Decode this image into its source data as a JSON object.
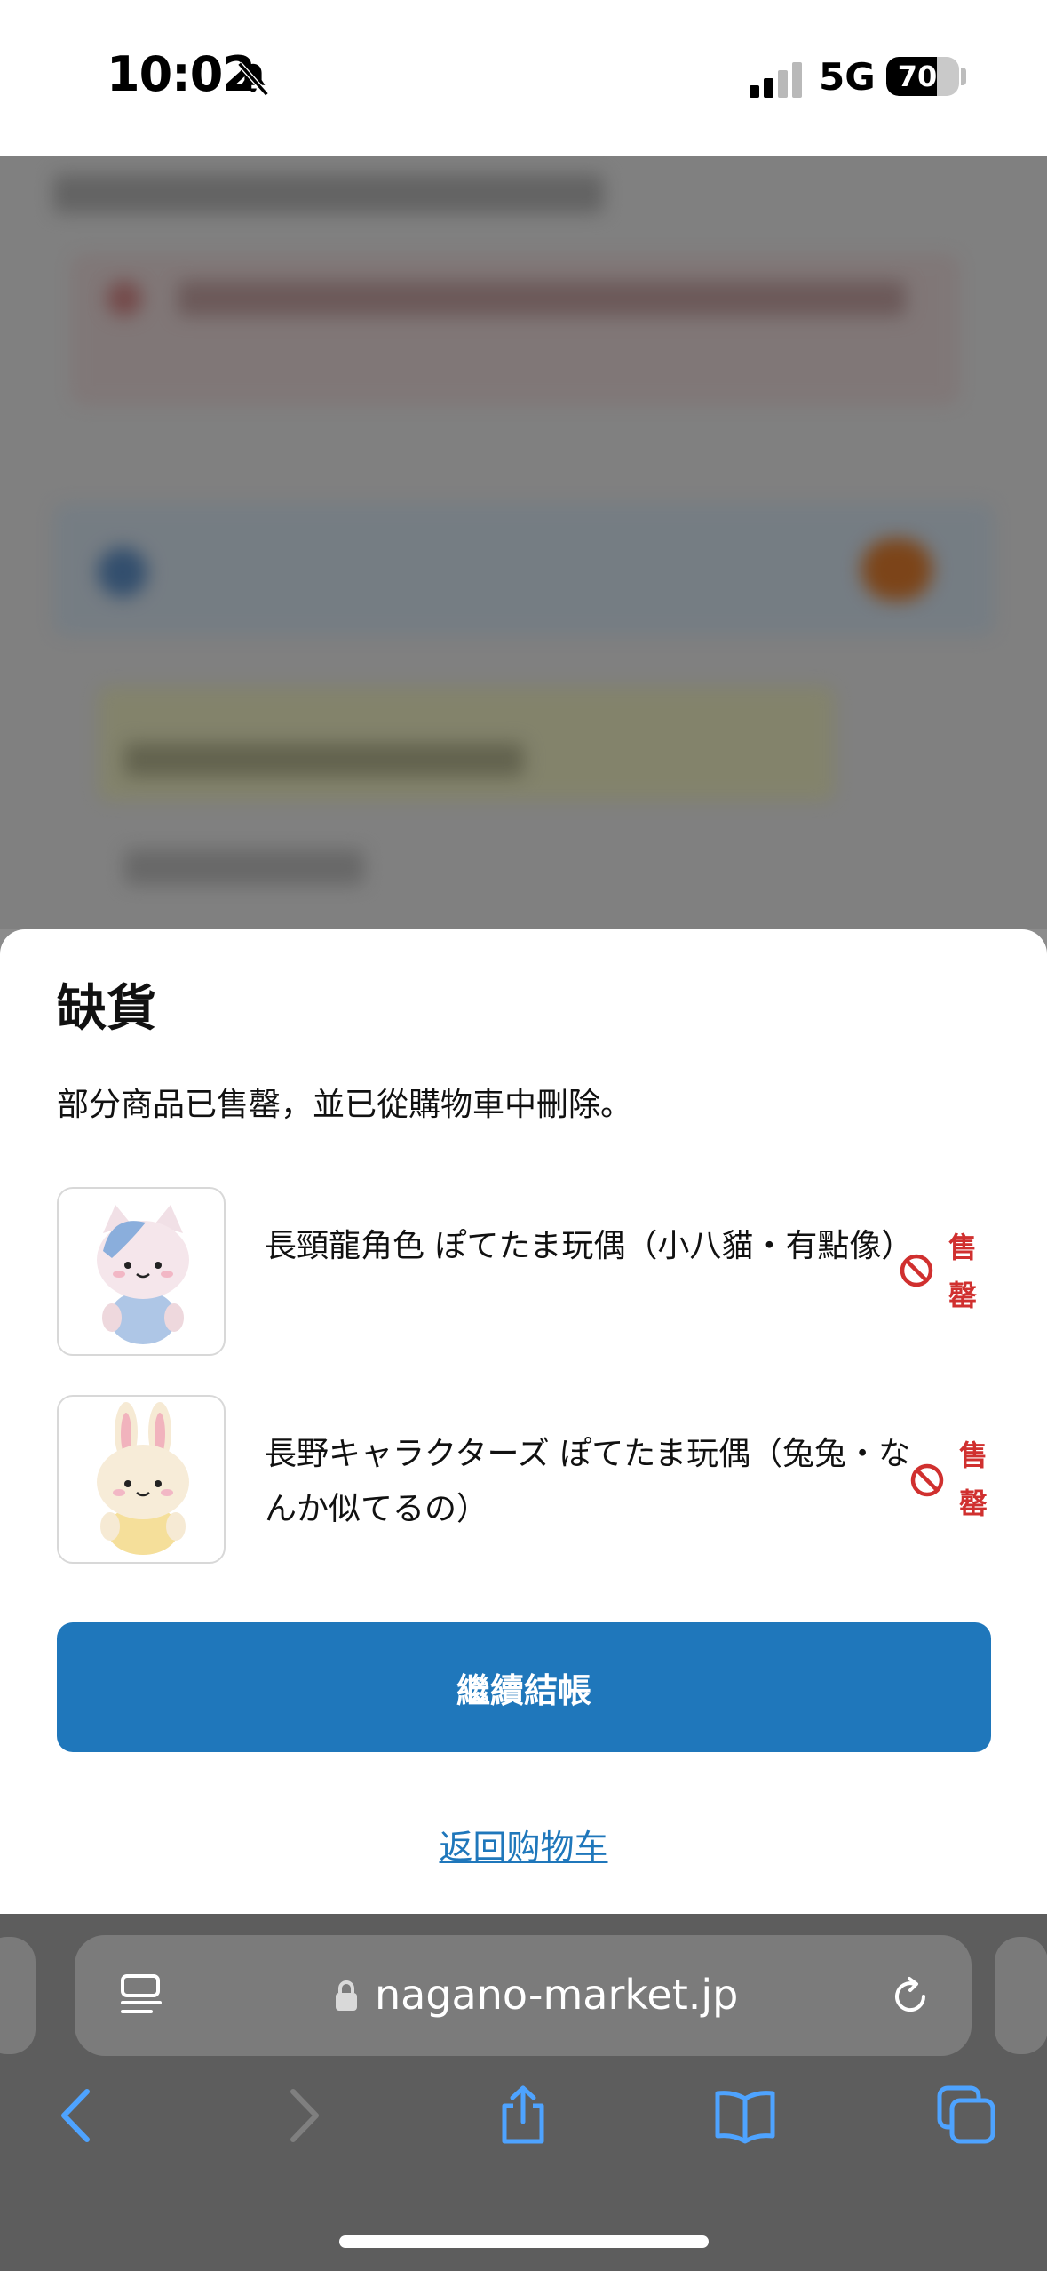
{
  "status_bar": {
    "time": "10:02",
    "network": "5G",
    "battery_percent": 70,
    "battery_label": "70"
  },
  "sheet": {
    "title": "缺貨",
    "message": "部分商品已售罄，並已從購物車中刪除。",
    "items": [
      {
        "name": "長頸龍角色 ぽてたま玩偶（小八貓・有點像）",
        "status_line1": "售",
        "status_line2": "罄",
        "thumb_icon": "cat-plush-icon"
      },
      {
        "name": "長野キャラクターズ ぽてたま玩偶（兔兔・なんか似てるの）",
        "status_line1": "售",
        "status_line2": "罄",
        "thumb_icon": "rabbit-plush-icon"
      }
    ],
    "continue_label": "繼續結帳",
    "back_label": "返回购物车"
  },
  "browser": {
    "address": "nagano-market.jp"
  },
  "colors": {
    "accent_blue": "#1f77bb",
    "soldout_red": "#d0302f",
    "toolbar_bg": "#5d5d5d",
    "toolbar_icon": "#4ea3ff"
  }
}
